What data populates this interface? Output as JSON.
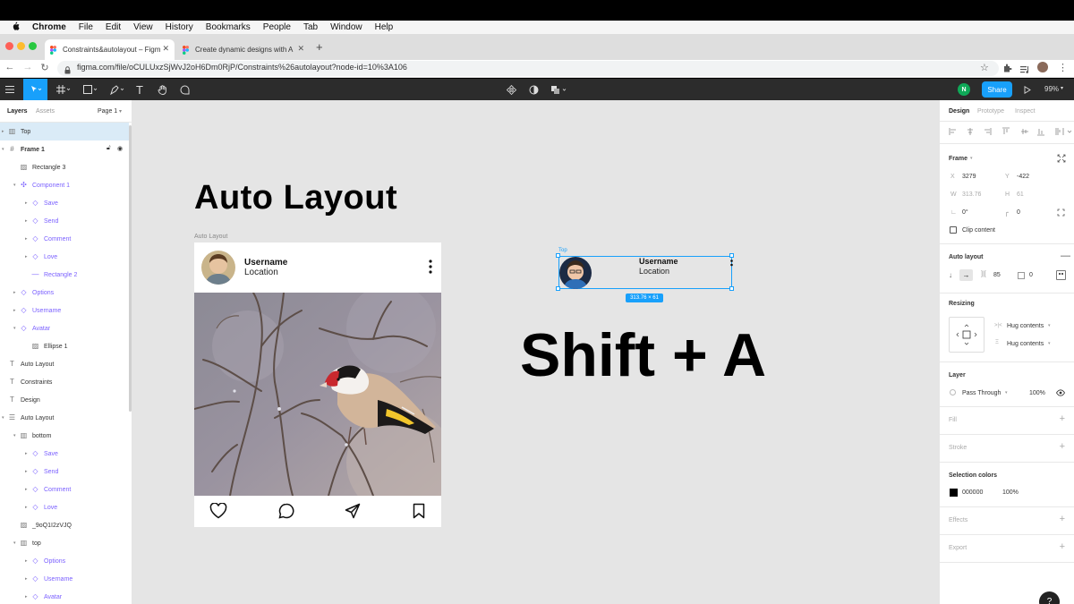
{
  "menubar": {
    "items": [
      "Chrome",
      "File",
      "Edit",
      "View",
      "History",
      "Bookmarks",
      "People",
      "Tab",
      "Window",
      "Help"
    ]
  },
  "browser": {
    "tabs": [
      {
        "title": "Constraints&autolayout – Figm",
        "active": true
      },
      {
        "title": "Create dynamic designs with A",
        "active": false
      }
    ],
    "url": "figma.com/file/oCULUxzSjWvJ2oH6Dm0RjP/Constraints%26autolayout?node-id=10%3A106"
  },
  "toolbar": {
    "share_label": "Share",
    "zoom": "99%",
    "user_initial": "N"
  },
  "left_panel": {
    "tab_layers": "Layers",
    "tab_assets": "Assets",
    "page": "Page 1",
    "layers": [
      {
        "label": "Top",
        "kind": "frame-grid",
        "indent": 0,
        "selected": true
      },
      {
        "label": "Frame 1",
        "kind": "frame",
        "indent": 0,
        "bold": true
      },
      {
        "label": "Rectangle 3",
        "kind": "image",
        "indent": 1
      },
      {
        "label": "Component 1",
        "kind": "component",
        "indent": 1
      },
      {
        "label": "Save",
        "kind": "instance",
        "indent": 2
      },
      {
        "label": "Send",
        "kind": "instance",
        "indent": 2
      },
      {
        "label": "Comment",
        "kind": "instance",
        "indent": 2
      },
      {
        "label": "Love",
        "kind": "instance",
        "indent": 2
      },
      {
        "label": "Rectangle 2",
        "kind": "line",
        "indent": 2
      },
      {
        "label": "Options",
        "kind": "instance",
        "indent": 1
      },
      {
        "label": "Username",
        "kind": "instance",
        "indent": 1
      },
      {
        "label": "Avatar",
        "kind": "instance",
        "indent": 1
      },
      {
        "label": "Ellipse 1",
        "kind": "image",
        "indent": 2
      },
      {
        "label": "Auto Layout",
        "kind": "text",
        "indent": 0
      },
      {
        "label": "Constraints",
        "kind": "text",
        "indent": 0
      },
      {
        "label": "Design",
        "kind": "text",
        "indent": 0
      },
      {
        "label": "Auto Layout",
        "kind": "autolayout",
        "indent": 0
      },
      {
        "label": "bottom",
        "kind": "frame-grid",
        "indent": 1
      },
      {
        "label": "Save",
        "kind": "instance",
        "indent": 2
      },
      {
        "label": "Send",
        "kind": "instance",
        "indent": 2
      },
      {
        "label": "Comment",
        "kind": "instance",
        "indent": 2
      },
      {
        "label": "Love",
        "kind": "instance",
        "indent": 2
      },
      {
        "label": "_9oQ1I2zVJQ",
        "kind": "image",
        "indent": 1
      },
      {
        "label": "top",
        "kind": "frame-grid",
        "indent": 1
      },
      {
        "label": "Options",
        "kind": "instance",
        "indent": 2
      },
      {
        "label": "Username",
        "kind": "instance",
        "indent": 2
      },
      {
        "label": "Avatar",
        "kind": "instance",
        "indent": 2
      }
    ]
  },
  "canvas": {
    "heading": "Auto Layout",
    "frame_label": "Auto Layout",
    "card": {
      "username": "Username",
      "location": "Location"
    },
    "selection": {
      "label": "Top",
      "username": "Username",
      "location": "Location",
      "size": "313.76 × 61"
    },
    "shortcut": "Shift + A"
  },
  "right_panel": {
    "tab_design": "Design",
    "tab_prototype": "Prototype",
    "tab_inspect": "Inspect",
    "frame_title": "Frame",
    "x_label": "X",
    "x": "3279",
    "y_label": "Y",
    "y": "-422",
    "w_label": "W",
    "w": "313.76",
    "h_label": "H",
    "h": "61",
    "rotation": "0°",
    "radius": "0",
    "clip_content": "Clip content",
    "auto_layout_title": "Auto layout",
    "spacing": "85",
    "padding": "0",
    "resizing_title": "Resizing",
    "hug_h": "Hug contents",
    "hug_v": "Hug contents",
    "layer_title": "Layer",
    "blend": "Pass Through",
    "opacity": "100%",
    "fill_title": "Fill",
    "stroke_title": "Stroke",
    "selection_colors_title": "Selection colors",
    "sel_color_hex": "000000",
    "sel_color_opacity": "100%",
    "effects_title": "Effects",
    "export_title": "Export",
    "help": "?"
  },
  "colors": {
    "accent": "#18a0fb",
    "component": "#7b61ff",
    "toolbar_bg": "#2c2c2c",
    "canvas_bg": "#e5e5e5"
  }
}
